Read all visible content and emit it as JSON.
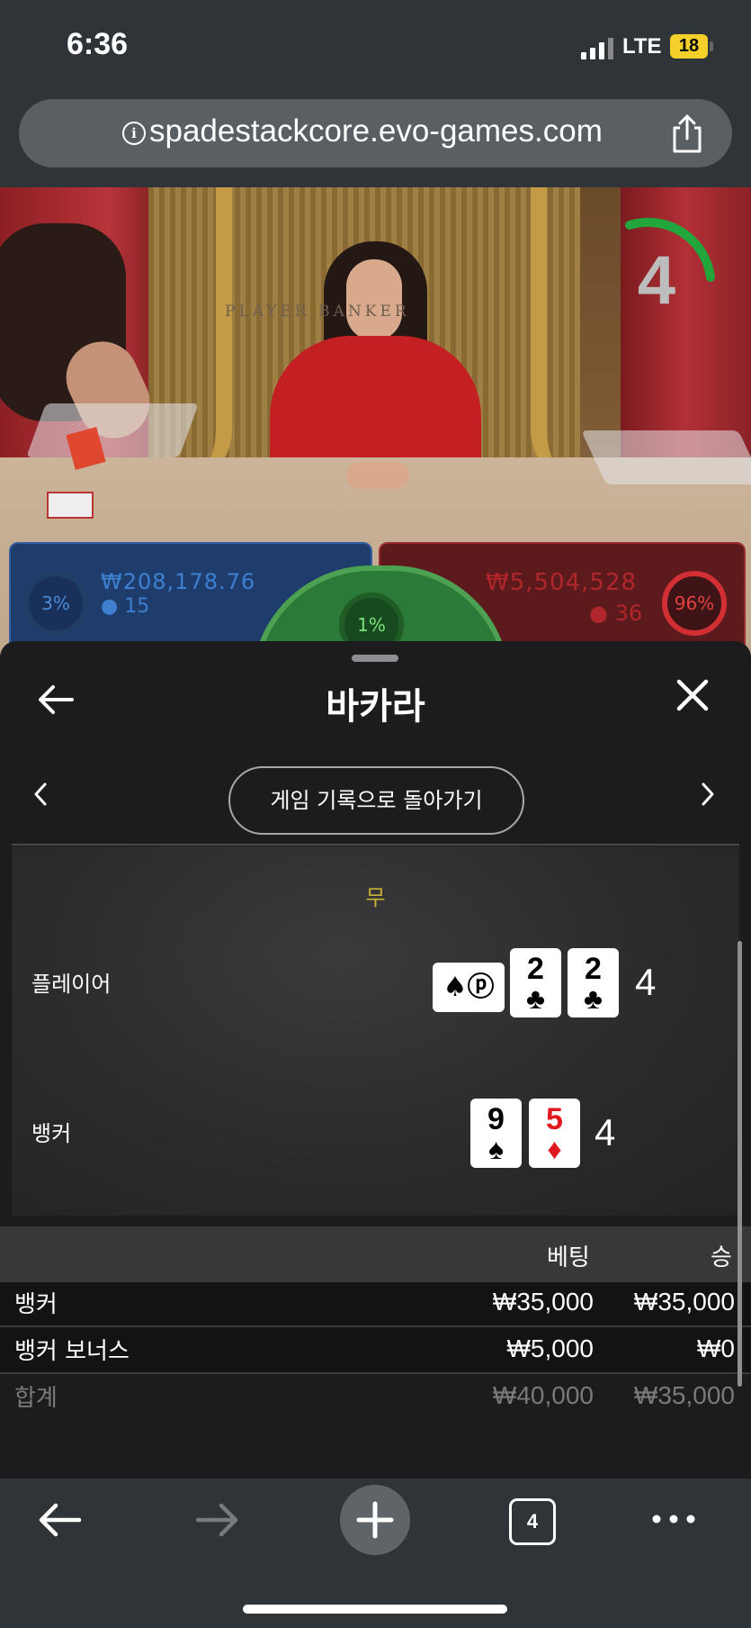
{
  "status": {
    "time": "6:36",
    "network": "LTE",
    "battery": "18"
  },
  "browser": {
    "url": "spadestackcore.evo-games.com",
    "tab_count": "4"
  },
  "stream": {
    "table_text": "PLAYER  BANKER",
    "countdown": "4",
    "player": {
      "percent": "3%",
      "amount": "₩208,178.76",
      "players": "15"
    },
    "banker": {
      "percent": "96%",
      "amount": "₩5,504,528",
      "players": "36"
    },
    "tie": {
      "percent": "1%"
    }
  },
  "sheet": {
    "title": "바카라",
    "history_button": "게임 기록으로 돌아가기",
    "outcome": "무",
    "player": {
      "label": "플레이어",
      "score": "4",
      "cards": [
        {
          "rank": "2",
          "suit": "♣",
          "color": "black"
        },
        {
          "rank": "2",
          "suit": "♣",
          "color": "black"
        }
      ],
      "card_back_logo": "♠ⓟ"
    },
    "banker": {
      "label": "뱅커",
      "score": "4",
      "cards": [
        {
          "rank": "9",
          "suit": "♠",
          "color": "black"
        },
        {
          "rank": "5",
          "suit": "♦",
          "color": "red"
        }
      ]
    },
    "bets": {
      "headers": {
        "bet": "베팅",
        "win": "승"
      },
      "rows": [
        {
          "name": "뱅커",
          "bet": "₩35,000",
          "win": "₩35,000"
        },
        {
          "name": "뱅커 보너스",
          "bet": "₩5,000",
          "win": "₩0"
        }
      ],
      "total": {
        "name": "합계",
        "bet": "₩40,000",
        "win": "₩35,000"
      }
    }
  },
  "colors": {
    "player": "#1e3d6d",
    "banker": "#5c1a1c",
    "tie": "#2c7a37",
    "outcome": "#c9b037"
  }
}
